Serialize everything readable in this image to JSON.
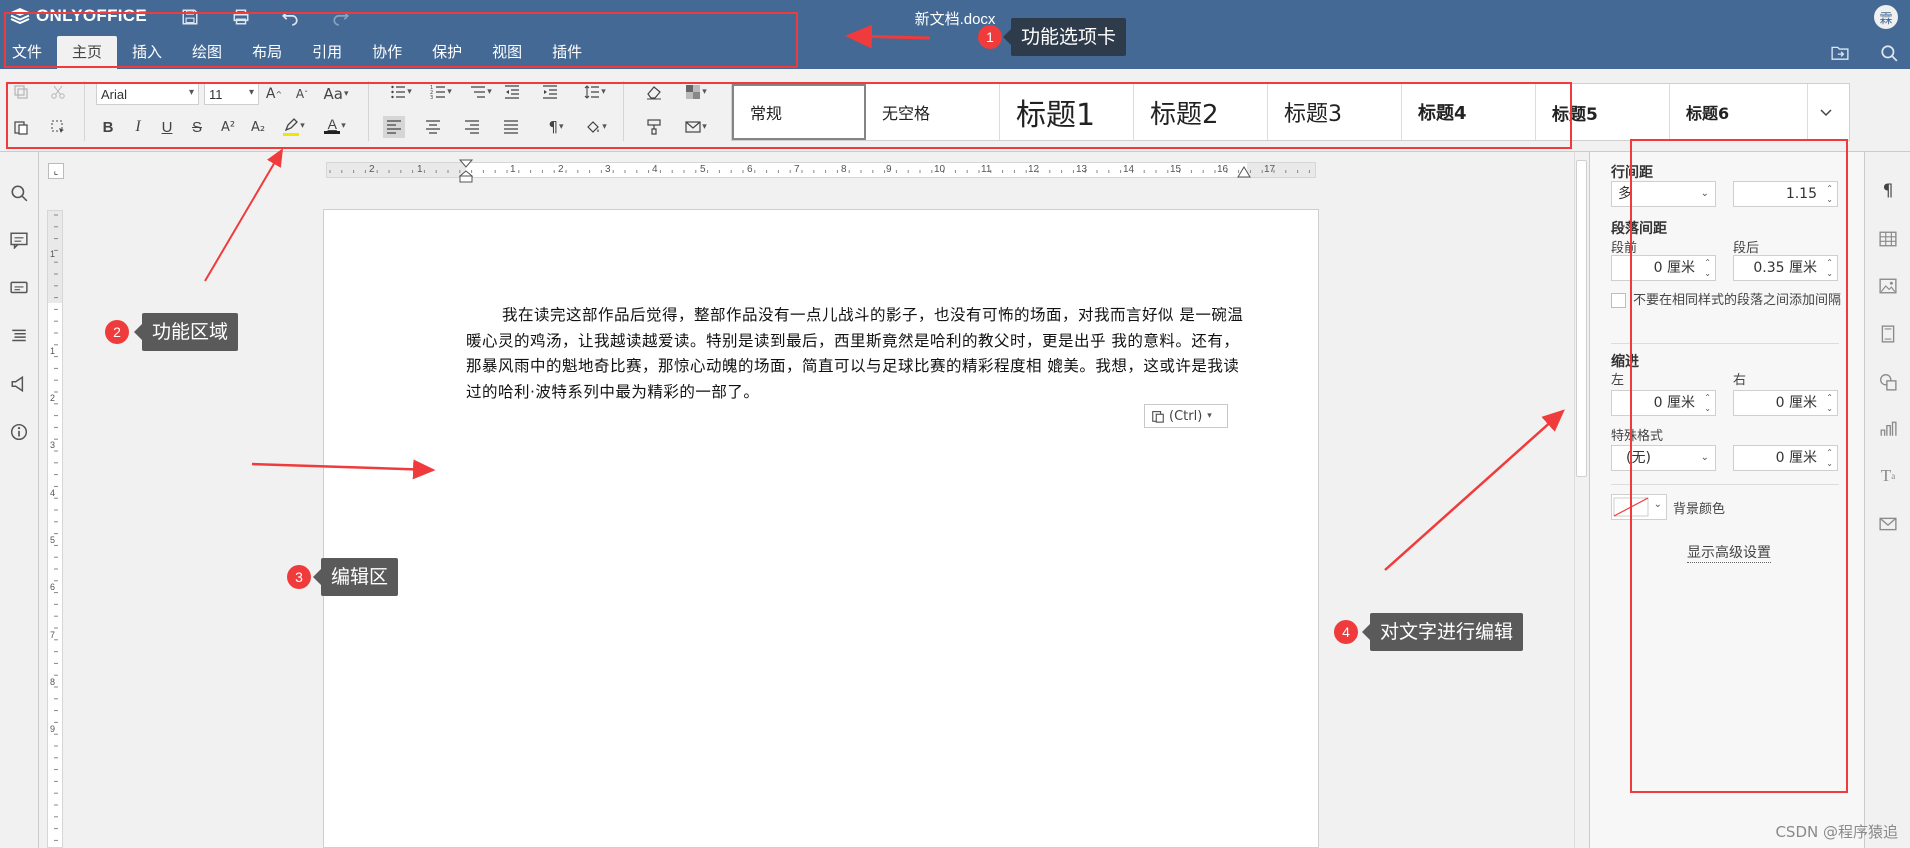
{
  "app": {
    "logo": "ONLYOFFICE",
    "doc_title": "新文档.docx",
    "user_initial": "霖"
  },
  "menu_tabs": [
    "文件",
    "主页",
    "插入",
    "绘图",
    "布局",
    "引用",
    "协作",
    "保护",
    "视图",
    "插件"
  ],
  "toolbar": {
    "font_name": "Arial",
    "font_size": "11",
    "font_size_up": "A",
    "font_size_down": "A",
    "change_case": "Aa",
    "bold": "B",
    "italic": "I",
    "underline": "U",
    "strike": "S",
    "superscript": "A²",
    "subscript": "A₂",
    "font_color": "A",
    "paragraph_mark": "¶",
    "styles": [
      "常规",
      "无空格",
      "标题1",
      "标题2",
      "标题3",
      "标题4",
      "标题5",
      "标题6"
    ],
    "colors": {
      "highlight": "#f5e400",
      "font": "#222222"
    }
  },
  "document": {
    "paragraph": "我在读完这部作品后觉得，整部作品没有一点儿战斗的影子，也没有可怖的场面，对我而言好似 是一碗温暖心灵的鸡汤，让我越读越爱读。特别是读到最后，西里斯竟然是哈利的教父时，更是出乎 我的意料。还有，那暴风雨中的魁地奇比赛，那惊心动魄的场面，简直可以与足球比赛的精彩程度相 媲美。我想，这或许是我读过的哈利·波特系列中最为精彩的一部了。",
    "paste_button": "(Ctrl)"
  },
  "ruler": {
    "h_numbers": [
      "2",
      "1",
      "1",
      "2",
      "3",
      "4",
      "5",
      "6",
      "7",
      "8",
      "9",
      "10",
      "11",
      "12",
      "13",
      "14",
      "15",
      "16",
      "17"
    ],
    "v_numbers": [
      "1",
      "1",
      "2",
      "3",
      "4",
      "5",
      "6",
      "7",
      "8",
      "9"
    ]
  },
  "paragraph_panel": {
    "line_spacing_label": "行间距",
    "line_spacing_type": "多",
    "line_spacing_value": "1.15",
    "para_spacing_label": "段落间距",
    "before_label": "段前",
    "before_value": "0 厘米",
    "after_label": "段后",
    "after_value": "0.35 厘米",
    "no_space_checkbox": "不要在相同样式的段落之间添加间隔",
    "indent_label": "缩进",
    "left_label": "左",
    "left_value": "0 厘米",
    "right_label": "右",
    "right_value": "0 厘米",
    "special_label": "特殊格式",
    "special_value": "(无)",
    "special_amount": "0 厘米",
    "bg_color_label": "背景颜色",
    "advanced_link": "显示高级设置"
  },
  "annotations": [
    {
      "num": "1",
      "text": "功能选项卡"
    },
    {
      "num": "2",
      "text": "功能区域"
    },
    {
      "num": "3",
      "text": "编辑区"
    },
    {
      "num": "4",
      "text": "对文字进行编辑"
    }
  ],
  "watermark": "CSDN @程序猿追",
  "colors": {
    "header": "#446995",
    "annotation": "#ef3b3b",
    "callout": "#5a5a5a"
  }
}
